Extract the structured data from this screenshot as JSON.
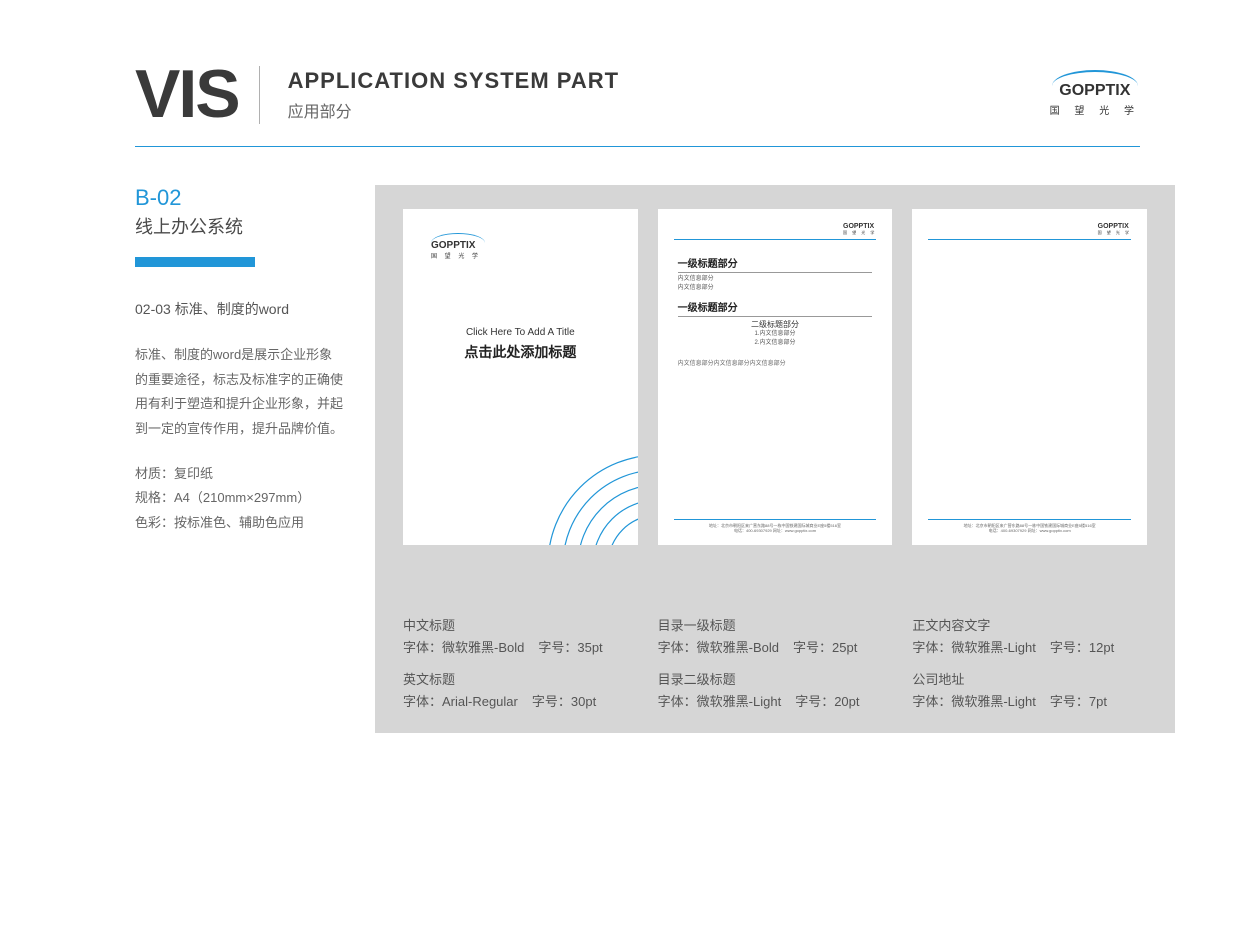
{
  "header": {
    "vis": "VIS",
    "title_en": "APPLICATION SYSTEM PART",
    "title_zh": "应用部分"
  },
  "brand": {
    "name_en": "GOPPTIX",
    "name_zh": "国 望 光 学"
  },
  "sidebar": {
    "code": "B-02",
    "system": "线上办公系统",
    "sub_title": "02-03  标准、制度的word",
    "description": "标准、制度的word是展示企业形象的重要途径，标志及标准字的正确使用有利于塑造和提升企业形象，并起到一定的宣传作用，提升品牌价值。",
    "spec_material": "材质：复印纸",
    "spec_size": "规格：A4（210mm×297mm）",
    "spec_color": "色彩：按标准色、辅助色应用"
  },
  "page1": {
    "logo_en": "GOPPTIX",
    "logo_zh": "国 望 光 学",
    "title_en": "Click Here To Add A Title",
    "title_zh": "点击此处添加标题"
  },
  "page2": {
    "logo_en": "GOPPTIX",
    "logo_zh": "国 望 光 学",
    "h1a": "一级标题部分",
    "line1": "内文信息部分",
    "line2": "内文信息部分",
    "h1b": "一级标题部分",
    "h2": "二级标题部分",
    "item1": "1.内文信息部分",
    "item2": "2.内文信息部分",
    "note": "内文信息部分内文信息部分内文信息部分",
    "footer_addr": "地址：北京市朝阳区来广营东路88号一栋中国铁建国际城商业E座5楼516室",
    "footer_tel": "电话：400-69307929        网址：www.gopptix.com"
  },
  "page3": {
    "logo_en": "GOPPTIX",
    "logo_zh": "国 望 光 学",
    "footer_addr": "地址：北京市朝阳区来广营东路88号一栋中国铁建国际城商业E座5楼516室",
    "footer_tel": "电话：400-69307929        网址：www.gopptix.com"
  },
  "captions": {
    "c1": {
      "title1": "中文标题",
      "font1": "字体：微软雅黑-Bold",
      "size1": "字号：35pt",
      "title2": "英文标题",
      "font2": "字体：Arial-Regular",
      "size2": "字号：30pt"
    },
    "c2": {
      "title1": "目录一级标题",
      "font1": "字体：微软雅黑-Bold",
      "size1": "字号：25pt",
      "title2": "目录二级标题",
      "font2": "字体：微软雅黑-Light",
      "size2": "字号：20pt"
    },
    "c3": {
      "title1": "正文内容文字",
      "font1": "字体：微软雅黑-Light",
      "size1": "字号：12pt",
      "title2": "公司地址",
      "font2": "字体：微软雅黑-Light",
      "size2": "字号：7pt"
    }
  }
}
